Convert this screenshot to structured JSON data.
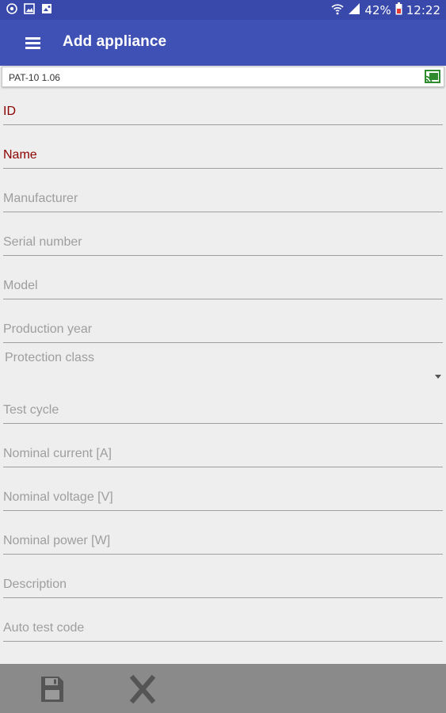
{
  "status_bar": {
    "battery": "42%",
    "time": "12:22",
    "icons": [
      "notification-icon",
      "gallery-icon",
      "image-icon",
      "wifi-icon",
      "signal-icon",
      "battery-icon"
    ]
  },
  "app_bar": {
    "title": "Add appliance",
    "menu_icon": "hamburger-menu-icon"
  },
  "device": {
    "name": "PAT-10 1.06",
    "status_icon": "cast-connected-icon"
  },
  "form": {
    "fields": [
      {
        "name": "id",
        "placeholder": "ID",
        "required": true
      },
      {
        "name": "name",
        "placeholder": "Name",
        "required": true
      },
      {
        "name": "manufacturer",
        "placeholder": "Manufacturer"
      },
      {
        "name": "serial-number",
        "placeholder": "Serial number"
      },
      {
        "name": "model",
        "placeholder": "Model"
      },
      {
        "name": "production-year",
        "placeholder": "Production year"
      }
    ],
    "protection_class": {
      "label": "Protection class",
      "value": ""
    },
    "fields2": [
      {
        "name": "test-cycle",
        "placeholder": "Test cycle"
      },
      {
        "name": "nominal-current",
        "placeholder": "Nominal current [A]"
      },
      {
        "name": "nominal-voltage",
        "placeholder": "Nominal voltage [V]"
      },
      {
        "name": "nominal-power",
        "placeholder": "Nominal power [W]"
      },
      {
        "name": "description",
        "placeholder": "Description"
      },
      {
        "name": "auto-test-code",
        "placeholder": "Auto test code"
      }
    ]
  },
  "actions": {
    "save_icon": "floppy-disk-icon",
    "cancel_icon": "close-icon"
  },
  "colors": {
    "app_bar": "#3f51b5",
    "status_bar": "#3949ab",
    "required_hint": "#8b0000",
    "hint": "#9e9e9e",
    "bottom_bar": "#8a8a8a",
    "cast_icon": "#2e8b2e"
  }
}
